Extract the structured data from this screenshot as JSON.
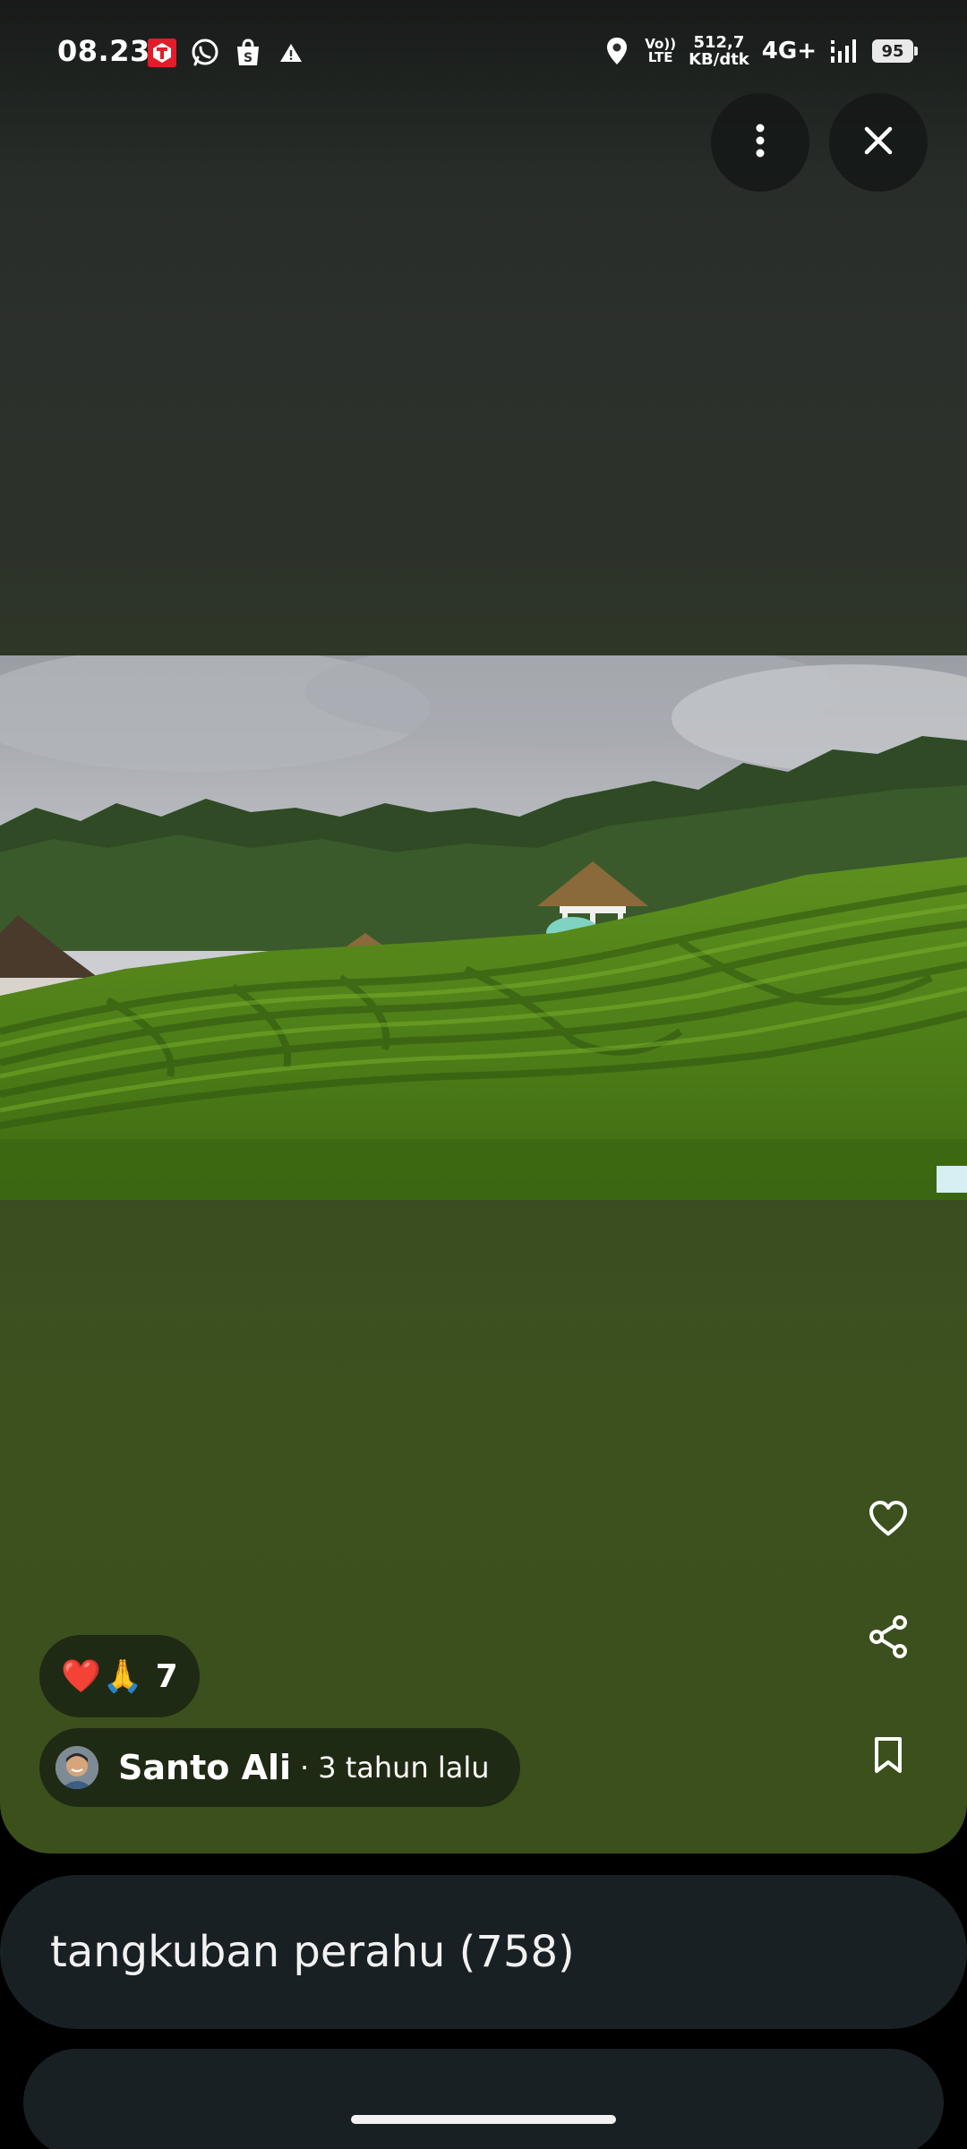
{
  "status_bar": {
    "time": "08.23",
    "left_icons": [
      "telkomsel-app-icon",
      "whatsapp-icon",
      "shopee-icon",
      "warning-icon"
    ],
    "volte_line1": "Vo))",
    "volte_line2": "LTE",
    "netspeed_line1": "512,7",
    "netspeed_line2": "KB/dtk",
    "network": "4G+",
    "battery": "95"
  },
  "viewer": {
    "more_icon": "more-vert-icon",
    "close_icon": "close-icon",
    "actions": {
      "like_icon": "heart-outline-icon",
      "share_icon": "share-icon",
      "save_icon": "bookmark-icon"
    }
  },
  "reactions": {
    "emoji": [
      "❤️",
      "🙏"
    ],
    "count": "7"
  },
  "author": {
    "name": "Santo Ali",
    "separator": "·",
    "time_ago": "3 tahun lalu"
  },
  "album": {
    "title": "tangkuban perahu (758)"
  },
  "colors": {
    "background": "#000000",
    "card": "#182024",
    "media_top": "#2b302c",
    "media_bottom": "#3c501c",
    "pill": "#161e12"
  }
}
